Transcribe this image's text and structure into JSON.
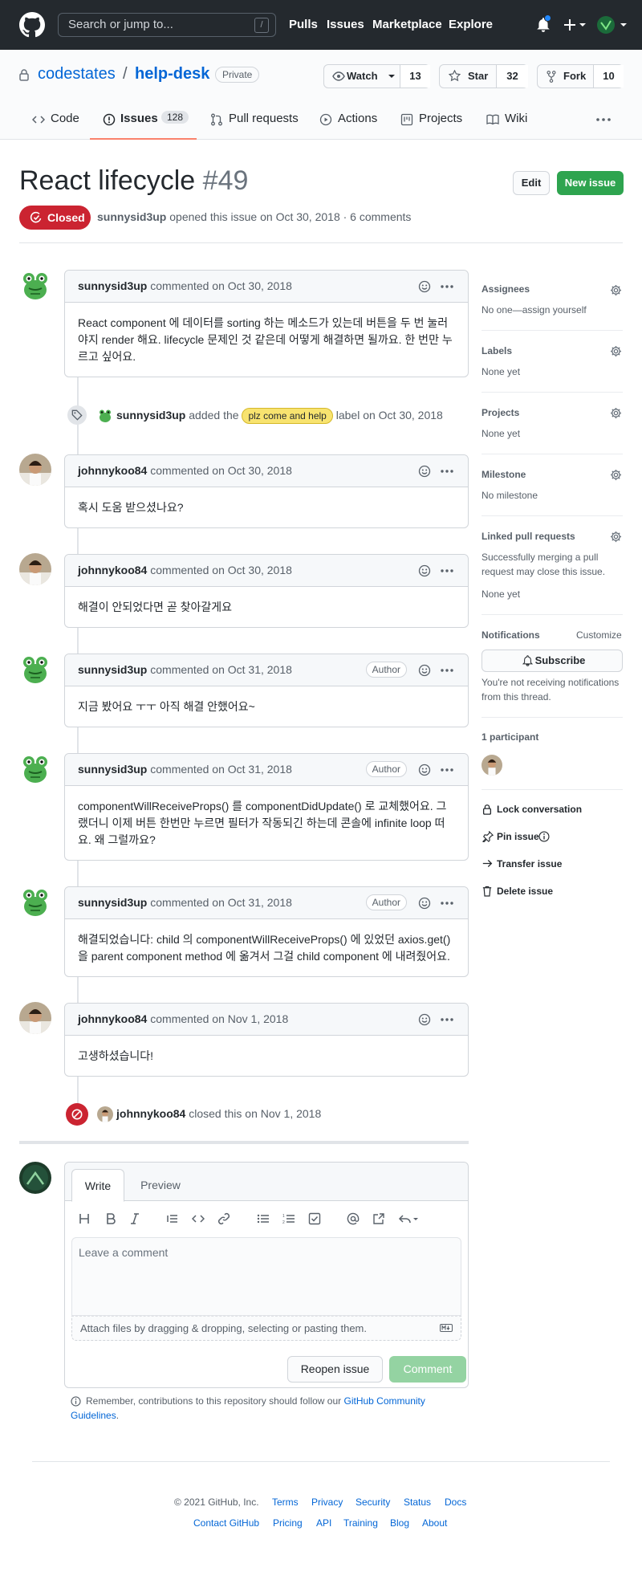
{
  "header": {
    "search_placeholder": "Search or jump to...",
    "search_shortcut": "/",
    "nav": [
      "Pulls",
      "Issues",
      "Marketplace",
      "Explore"
    ]
  },
  "repo": {
    "owner": "codestates",
    "separator": "/",
    "name": "help-desk",
    "visibility": "Private",
    "watch_label": "Watch",
    "watch_count": "13",
    "star_label": "Star",
    "star_count": "32",
    "fork_label": "Fork",
    "fork_count": "10"
  },
  "tabs": [
    {
      "label": "Code"
    },
    {
      "label": "Issues",
      "count": "128"
    },
    {
      "label": "Pull requests"
    },
    {
      "label": "Actions"
    },
    {
      "label": "Projects"
    },
    {
      "label": "Wiki"
    }
  ],
  "issue": {
    "title": "React lifecycle",
    "number": "#49",
    "edit_label": "Edit",
    "new_issue_label": "New issue",
    "state": "Closed",
    "opened_by": "sunnysid3up",
    "opened_text": "opened this issue on Oct 30, 2018 · 6 comments"
  },
  "comments": [
    {
      "author": "sunnysid3up",
      "when": "commented on Oct 30, 2018",
      "badge": "",
      "body": "React component 에 데이터를 sorting 하는 메소드가 있는데 버튼을 두 번 눌러야지 render 해요. lifecycle 문제인 것 같은데 어떻게 해결하면 될까요. 한 번만 누르고 싶어요."
    },
    {
      "author": "johnnykoo84",
      "when": "commented on Oct 30, 2018",
      "badge": "",
      "body": "혹시 도움 받으셨나요?"
    },
    {
      "author": "johnnykoo84",
      "when": "commented on Oct 30, 2018",
      "badge": "",
      "body": "해결이 안되었다면 곧 찾아갈게요"
    },
    {
      "author": "sunnysid3up",
      "when": "commented on Oct 31, 2018",
      "badge": "Author",
      "body": "지금 봤어요 ㅜㅜ 아직 해결 안했어요~"
    },
    {
      "author": "sunnysid3up",
      "when": "commented on Oct 31, 2018",
      "badge": "Author",
      "body": "componentWillReceiveProps() 를 componentDidUpdate() 로 교체했어요. 그랬더니 이제 버튼 한번만 누르면 필터가 작동되긴 하는데 콘솔에 infinite loop 떠요. 왜 그럴까요?"
    },
    {
      "author": "sunnysid3up",
      "when": "commented on Oct 31, 2018",
      "badge": "Author",
      "body": "해결되었습니다: child 의 componentWillReceiveProps() 에 있었던 axios.get() 을 parent component method 에 옮겨서 그걸 child component 에 내려줬어요."
    },
    {
      "author": "johnnykoo84",
      "when": "commented on Nov 1, 2018",
      "badge": "",
      "body": "고생하셨습니다!"
    }
  ],
  "events": {
    "label_event": {
      "actor": "sunnysid3up",
      "before": "added the",
      "label": "plz come and help",
      "after": "label on Oct 30, 2018"
    },
    "closed_event": {
      "actor": "johnnykoo84",
      "text": "closed this on Nov 1, 2018"
    }
  },
  "sidebar": {
    "assignees": {
      "title": "Assignees",
      "value": "No one—assign yourself"
    },
    "labels": {
      "title": "Labels",
      "value": "None yet"
    },
    "projects": {
      "title": "Projects",
      "value": "None yet"
    },
    "milestone": {
      "title": "Milestone",
      "value": "No milestone"
    },
    "linked": {
      "title": "Linked pull requests",
      "desc": "Successfully merging a pull request may close this issue.",
      "value": "None yet"
    },
    "notifications": {
      "title": "Notifications",
      "customize": "Customize",
      "subscribe": "Subscribe",
      "desc": "You're not receiving notifications from this thread."
    },
    "participants": {
      "title": "1 participant"
    },
    "actions": [
      "Lock conversation",
      "Pin issue",
      "Transfer issue",
      "Delete issue"
    ]
  },
  "editor": {
    "tabs": [
      "Write",
      "Preview"
    ],
    "placeholder": "Leave a comment",
    "attach_hint": "Attach files by dragging & dropping, selecting or pasting them.",
    "reopen_label": "Reopen issue",
    "comment_label": "Comment",
    "remember_text": "Remember, contributions to this repository should follow our",
    "remember_link": "GitHub Community Guidelines",
    "remember_end": "."
  },
  "footer": {
    "copyright": "© 2021 GitHub, Inc.",
    "row1": [
      "Terms",
      "Privacy",
      "Security",
      "Status",
      "Docs"
    ],
    "row2": [
      "Contact GitHub",
      "Pricing",
      "API",
      "Training",
      "Blog",
      "About"
    ]
  },
  "colors": {
    "header_bg": "#24292e",
    "closed": "#cb2431",
    "new_issue": "#2ea44f",
    "link": "#0366d6",
    "label": "#f8e36f"
  }
}
